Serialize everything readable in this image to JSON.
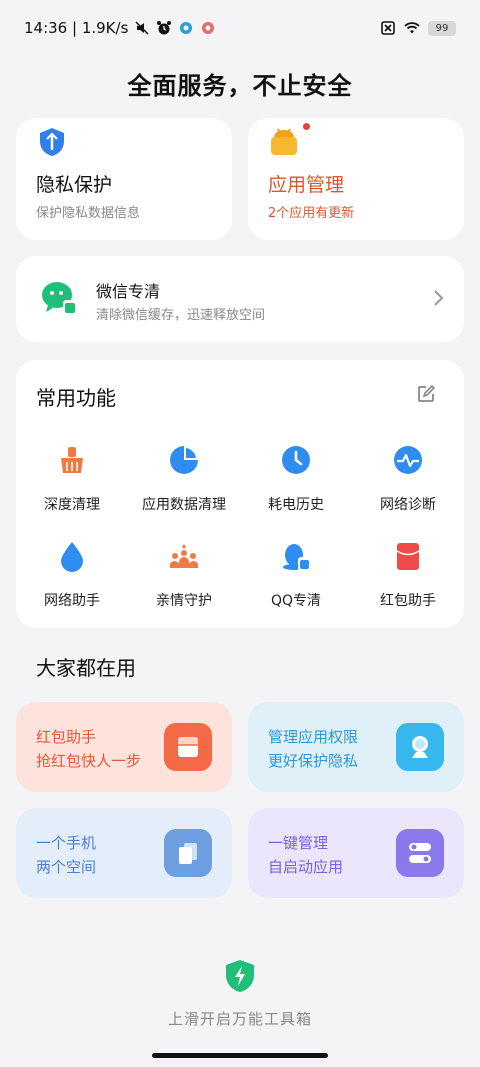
{
  "status_bar": {
    "time_speed": "14:36 | 1.9K/s",
    "battery": "99",
    "icons": [
      "mute-icon",
      "alarm-icon",
      "app-notification-icon",
      "app-notification-icon",
      "sim-icon",
      "wifi-icon",
      "battery-icon"
    ]
  },
  "headline": "全面服务，不止安全",
  "feature_cards": [
    {
      "title": "隐私保护",
      "subtitle": "保护隐私数据信息",
      "icon": "privacy-shield-icon",
      "accent": "#2f80ed"
    },
    {
      "title": "应用管理",
      "subtitle": "2个应用有更新",
      "icon": "android-app-icon",
      "accent": "#e0552b"
    }
  ],
  "wechat_clean": {
    "title": "微信专清",
    "subtitle": "清除微信缓存，迅速释放空间",
    "icon": "wechat-clean-icon",
    "accent": "#1fbf7a"
  },
  "common_tools": {
    "title": "常用功能",
    "edit_icon": "edit-icon",
    "items": [
      {
        "label": "深度清理",
        "icon": "broom-icon"
      },
      {
        "label": "应用数据清理",
        "icon": "pie-chart-icon"
      },
      {
        "label": "耗电历史",
        "icon": "clock-icon"
      },
      {
        "label": "网络诊断",
        "icon": "network-pulse-icon"
      },
      {
        "label": "网络助手",
        "icon": "water-drop-icon"
      },
      {
        "label": "亲情守护",
        "icon": "family-icon"
      },
      {
        "label": "QQ专清",
        "icon": "qq-clean-icon"
      },
      {
        "label": "红包助手",
        "icon": "red-envelope-icon"
      }
    ]
  },
  "popular": {
    "title": "大家都在用",
    "items": [
      {
        "line1": "红包助手",
        "line2": "抢红包快人一步",
        "icon": "red-envelope-icon",
        "bg": "#fde3dc",
        "text_color": "#e2563c",
        "icon_bg": "#f26b46"
      },
      {
        "line1": "管理应用权限",
        "line2": "更好保护隐私",
        "icon": "permission-icon",
        "bg": "#dff0f8",
        "text_color": "#2f98cf",
        "icon_bg": "#38b6ee"
      },
      {
        "line1": "一个手机",
        "line2": "两个空间",
        "icon": "dual-space-icon",
        "bg": "#e4eefb",
        "text_color": "#4d7fc6",
        "icon_bg": "#6d9fe0"
      },
      {
        "line1": "一键管理",
        "line2": "自启动应用",
        "icon": "autostart-toggle-icon",
        "bg": "#ebe6fb",
        "text_color": "#7662d6",
        "icon_bg": "#8b78ea"
      }
    ]
  },
  "bottom_hint": {
    "text": "上滑开启万能工具箱",
    "icon": "toolbox-shield-icon"
  }
}
